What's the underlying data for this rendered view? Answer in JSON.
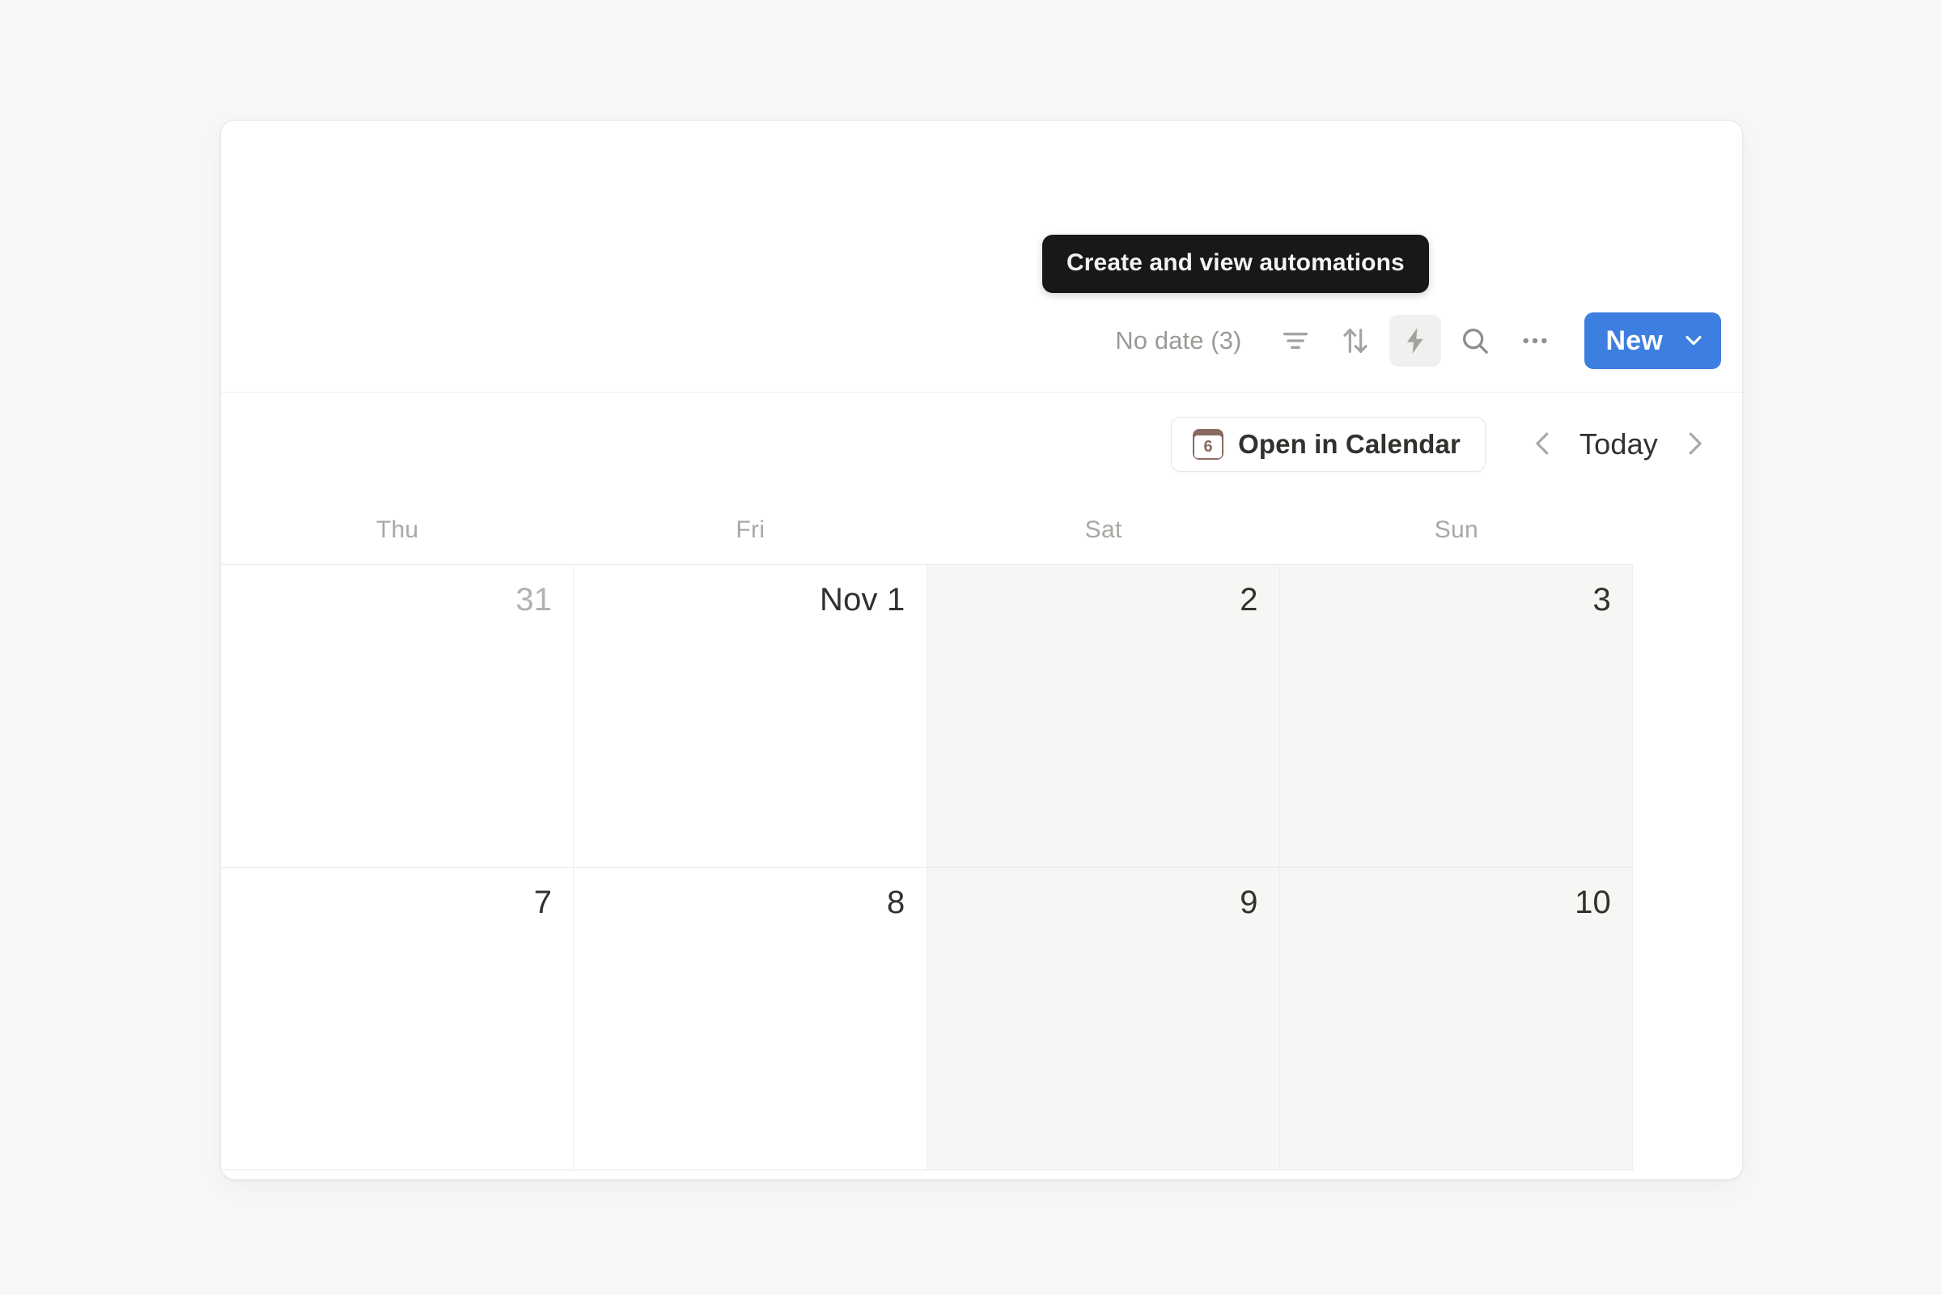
{
  "toolbar": {
    "no_date_label": "No date (3)",
    "filter_icon": "filter-icon",
    "sort_icon": "sort-icon",
    "automation_icon": "lightning-bolt-icon",
    "search_icon": "search-icon",
    "more_icon": "ellipsis-icon",
    "new_label": "New",
    "new_chevron_icon": "chevron-down-icon",
    "new_button_color": "#3d7fe0"
  },
  "tooltip": {
    "text": "Create and view automations",
    "background": "#18181a",
    "foreground": "#f3f3f1"
  },
  "subheader": {
    "open_in_calendar_label": "Open in Calendar",
    "calendar_icon_day": "6",
    "calendar_icon_color": "#8a6a63",
    "prev_icon": "chevron-left-icon",
    "today_label": "Today",
    "next_icon": "chevron-right-icon"
  },
  "calendar": {
    "day_headers": [
      "Thu",
      "Fri",
      "Sat",
      "Sun"
    ],
    "weeks": [
      [
        {
          "label": "31",
          "muted": true,
          "weekend": false
        },
        {
          "label": "Nov 1",
          "muted": false,
          "weekend": false
        },
        {
          "label": "2",
          "muted": false,
          "weekend": true
        },
        {
          "label": "3",
          "muted": false,
          "weekend": true
        }
      ],
      [
        {
          "label": "7",
          "muted": false,
          "weekend": false
        },
        {
          "label": "8",
          "muted": false,
          "weekend": false
        },
        {
          "label": "9",
          "muted": false,
          "weekend": true
        },
        {
          "label": "10",
          "muted": false,
          "weekend": true
        }
      ]
    ]
  }
}
